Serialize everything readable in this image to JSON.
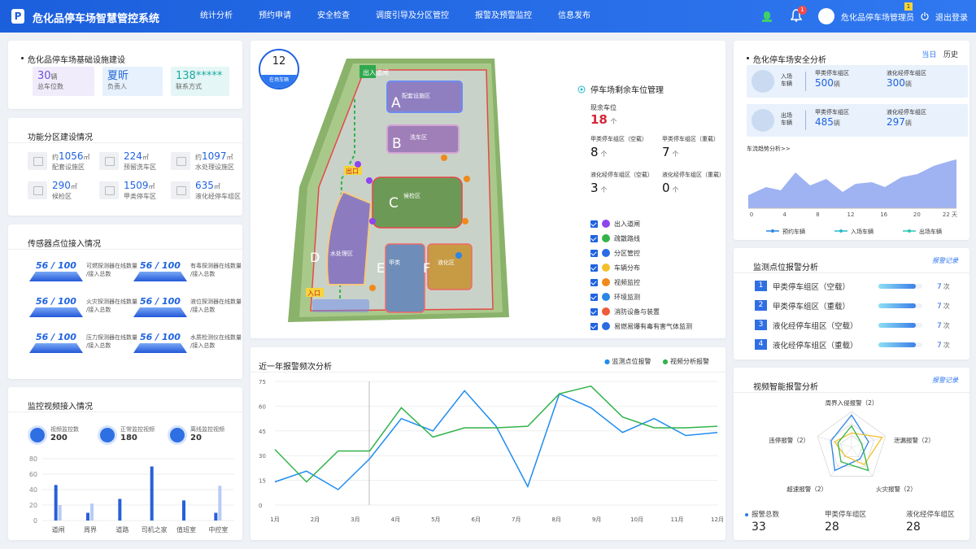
{
  "header": {
    "logo": "P",
    "title": "危化品停车场智慧管控系统",
    "nav": [
      "统计分析",
      "预约申请",
      "安全检查",
      "调度引导及分区管控",
      "报警及预警监控",
      "信息发布"
    ],
    "notif_count": "1",
    "user": "危化品停车场管理员",
    "user_badge": "1",
    "logout": "退出登录"
  },
  "infra": {
    "title": "危化品停车场基础设施建设",
    "tiles": [
      {
        "value": "30",
        "unit": "辆",
        "label": "总车位数"
      },
      {
        "value": "夏昕",
        "unit": "",
        "label": "负责人"
      },
      {
        "value": "138*****",
        "unit": "",
        "label": "联系方式"
      }
    ]
  },
  "zones": {
    "title": "功能分区建设情况",
    "items": [
      {
        "prefix": "约",
        "value": "1056",
        "unit": "㎡",
        "label": "配套设施区"
      },
      {
        "prefix": "",
        "value": "224",
        "unit": "㎡",
        "label": "预留洗车区"
      },
      {
        "prefix": "约",
        "value": "1097",
        "unit": "㎡",
        "label": "水处理设施区"
      },
      {
        "prefix": "",
        "value": "290",
        "unit": "㎡",
        "label": "候检区"
      },
      {
        "prefix": "",
        "value": "1509",
        "unit": "㎡",
        "label": "甲类停车区"
      },
      {
        "prefix": "",
        "value": "635",
        "unit": "㎡",
        "label": "液化经停车组区"
      }
    ]
  },
  "sensors": {
    "title": "传感器点位接入情况",
    "items": [
      {
        "value": "56 / 100",
        "l1": "可燃探测器在线数量",
        "l2": "/接入总数"
      },
      {
        "value": "56 / 100",
        "l1": "有毒探测器在线数量",
        "l2": "/接入总数"
      },
      {
        "value": "56 / 100",
        "l1": "火灾探测器在线数量",
        "l2": "/接入总数"
      },
      {
        "value": "56 / 100",
        "l1": "液位探测器在线数量",
        "l2": "/接入总数"
      },
      {
        "value": "56 / 100",
        "l1": "压力探测器在线数量",
        "l2": "/接入总数"
      },
      {
        "value": "56 / 100",
        "l1": "水质检测仪在线数量",
        "l2": "/接入总数"
      }
    ]
  },
  "video": {
    "title": "监控视频接入情况",
    "stats": [
      {
        "label": "视频监控数",
        "value": "200"
      },
      {
        "label": "正常监控视频",
        "value": "180"
      },
      {
        "label": "离线监控视频",
        "value": "20"
      }
    ]
  },
  "video_chart": {
    "type": "bar",
    "categories": [
      "道闸",
      "周界",
      "道路",
      "司机之家",
      "值班室",
      "中控室"
    ],
    "series": [
      {
        "name": "",
        "values": [
          46,
          10,
          28,
          70,
          26,
          10
        ]
      },
      {
        "name": "",
        "values": [
          20,
          22,
          0,
          0,
          0,
          45
        ]
      }
    ],
    "ylim": [
      0,
      80
    ],
    "yticks": [
      "80",
      "60",
      "40",
      "20",
      "0"
    ],
    "colors": [
      "#2a5fd9",
      "#b6ccf6"
    ]
  },
  "map": {
    "count": "12",
    "count_label": "在场车辆",
    "labels": [
      "A",
      "B",
      "C",
      "D",
      "E",
      "F"
    ],
    "zone_a": "配套设施区",
    "zone_b": "洗车区",
    "zone_c": "候检区",
    "zone_d": "水处理区",
    "zone_e": "甲类",
    "zone_f": "液化区",
    "exit": "出口",
    "entry": "入口",
    "route": "出入道闸"
  },
  "parking": {
    "title": "停车场剩余车位管理",
    "remain_label": "现余车位",
    "remain": "18",
    "remain_unit": "个",
    "cells": [
      {
        "label": "甲类停车组区（空载）",
        "value": "8",
        "unit": "个"
      },
      {
        "label": "甲类停车组区（重载）",
        "value": "7",
        "unit": "个"
      },
      {
        "label": "液化经停车组区（空载）",
        "value": "3",
        "unit": "个"
      },
      {
        "label": "液化经停车组区（重载）",
        "value": "0",
        "unit": "个"
      }
    ],
    "legend": [
      {
        "label": "出入道闸",
        "color": "#8e44ef"
      },
      {
        "label": "疏散路线",
        "color": "#34b34a"
      },
      {
        "label": "分区管控",
        "color": "#2b6be6"
      },
      {
        "label": "车辆分布",
        "color": "#f3c02c"
      },
      {
        "label": "视频监控",
        "color": "#f08a1c"
      },
      {
        "label": "环境监测",
        "color": "#2b86e6"
      },
      {
        "label": "消防设备与装置",
        "color": "#f05b3a"
      },
      {
        "label": "易燃易爆有毒有害气体监测",
        "color": "#2a6de0"
      }
    ]
  },
  "alarm_chart": {
    "type": "line",
    "title": "近一年报警频次分析",
    "series": [
      {
        "name": "监测点位报警",
        "values": [
          15,
          22,
          10,
          30,
          56,
          48,
          74,
          51,
          12,
          72,
          63,
          47,
          56,
          45,
          47
        ]
      },
      {
        "name": "视频分析报警",
        "values": [
          36,
          15,
          35,
          35,
          63,
          44,
          50,
          50,
          51,
          72,
          77,
          57,
          50,
          50,
          51
        ]
      }
    ],
    "x": [
      "1月",
      "2月",
      "3月",
      "4月",
      "5月",
      "6月",
      "7月",
      "8月",
      "9月",
      "10月",
      "11月",
      "12月"
    ],
    "ylim": [
      0,
      80
    ],
    "yticks": [
      "75",
      "60",
      "45",
      "30",
      "15",
      "0"
    ],
    "colors": [
      "#1f8cf0",
      "#31b44a"
    ]
  },
  "safety": {
    "title": "危化停车场安全分析",
    "tab_today": "当日",
    "tab_history": "历史",
    "rows": [
      {
        "label1": "入场",
        "label2": "车辆",
        "a_label": "甲类停车组区",
        "a_value": "500",
        "a_unit": "辆",
        "b_label": "液化经停车组区",
        "b_value": "300",
        "b_unit": "辆"
      },
      {
        "label1": "出场",
        "label2": "车辆",
        "a_label": "甲类停车组区",
        "a_value": "485",
        "a_unit": "辆",
        "b_label": "液化经停车组区",
        "b_value": "297",
        "b_unit": "辆"
      }
    ],
    "trend_title": "车流趋势分析>>"
  },
  "trend_chart": {
    "type": "area",
    "x": [
      "0",
      "4",
      "8",
      "12",
      "16",
      "20",
      "22 天"
    ],
    "legend": [
      "预约车辆",
      "入场车辆",
      "出场车辆"
    ],
    "colors": [
      "#2a86e6",
      "#28b9c9",
      "#28c9b0"
    ]
  },
  "monitor": {
    "title": "监测点位报警分析",
    "link": "报警记录",
    "items": [
      {
        "rank": "1",
        "label": "甲类停车组区（空载）",
        "value": "7",
        "unit": "次",
        "pct": 0.85
      },
      {
        "rank": "2",
        "label": "甲类停车组区（重载）",
        "value": "7",
        "unit": "次",
        "pct": 0.85
      },
      {
        "rank": "3",
        "label": "液化经停车组区（空载）",
        "value": "7",
        "unit": "次",
        "pct": 0.85
      },
      {
        "rank": "4",
        "label": "液化经停车组区（重载）",
        "value": "7",
        "unit": "次",
        "pct": 0.85
      }
    ]
  },
  "videoalarm": {
    "title": "视频智能报警分析",
    "link": "报警记录",
    "radar": [
      "周界入侵报警（2）",
      "泄漏报警（2）",
      "火灾报警（2）",
      "超速报警（2）",
      "违停报警（2）"
    ],
    "totals": [
      {
        "label": "报警总数",
        "value": "33"
      },
      {
        "label": "甲类停车组区",
        "value": "28"
      },
      {
        "label": "液化经停车组区",
        "value": "28"
      }
    ]
  }
}
